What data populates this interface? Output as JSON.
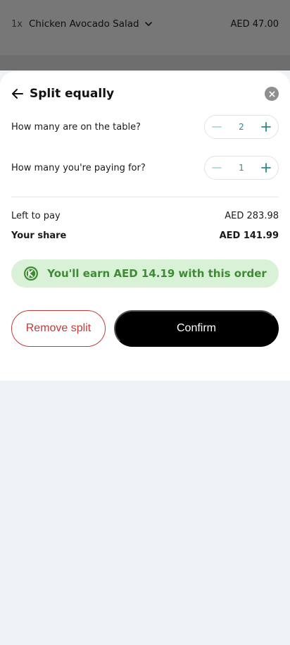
{
  "background": {
    "item": {
      "qty": "1x",
      "name": "Chicken Avocado Salad",
      "price": "AED 47.00",
      "chevron_icon": "chevron-down-icon"
    }
  },
  "sheet": {
    "title": "Split equally",
    "back_icon": "arrow-left-icon",
    "close_icon": "close-circle-icon",
    "rows": [
      {
        "label": "How many are on the table?",
        "value": "2"
      },
      {
        "label": "How many you're paying for?",
        "value": "1"
      }
    ],
    "summary": {
      "left_label": "Left to pay",
      "left_value": "AED 283.98",
      "share_label": "Your share",
      "share_value": "AED 141.99"
    },
    "earn": {
      "text": "You'll earn AED 14.19 with this order",
      "icon": "rewards-icon"
    },
    "actions": {
      "remove_label": "Remove split",
      "confirm_label": "Confirm"
    }
  },
  "colors": {
    "accent_teal": "#2c8a8a",
    "danger": "#c23a3a",
    "earn_bg": "#d9f2d7",
    "earn_text": "#3e8a35",
    "overlay": "#777777",
    "page_bg": "#eff3f6"
  }
}
